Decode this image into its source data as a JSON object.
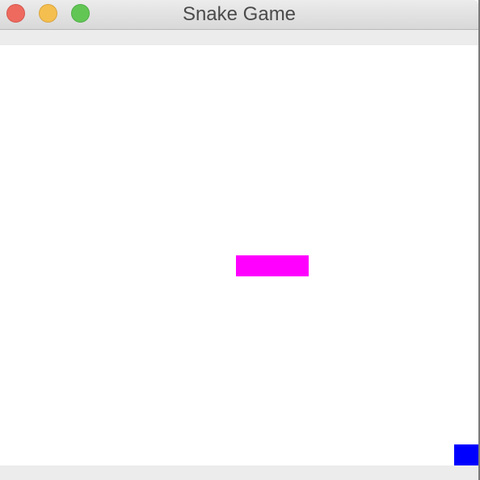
{
  "window": {
    "title": "Snake Game"
  },
  "colors": {
    "snake": "#ff00ff",
    "food": "#0000ff",
    "background": "#ffffff"
  }
}
